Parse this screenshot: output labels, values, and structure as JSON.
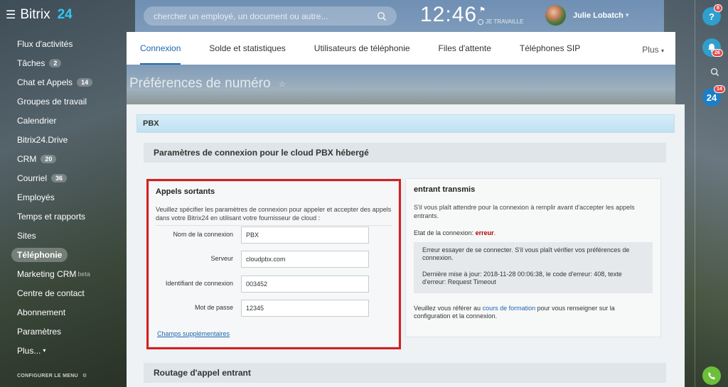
{
  "topbar": {
    "logo_text": "Bitrix",
    "logo_num": "24",
    "search_placeholder": "chercher un employé, un document ou autre...",
    "clock": "12:46",
    "work_status": "JE TRAVAILLE",
    "user_name": "Julie Lobatch"
  },
  "leftmenu": {
    "items": [
      {
        "label": "Flux d'activités"
      },
      {
        "label": "Tâches",
        "badge": "2"
      },
      {
        "label": "Chat et Appels",
        "badge": "14"
      },
      {
        "label": "Groupes de travail"
      },
      {
        "label": "Calendrier"
      },
      {
        "label": "Bitrix24.Drive"
      },
      {
        "label": "CRM",
        "badge": "20"
      },
      {
        "label": "Courriel",
        "badge": "36"
      },
      {
        "label": "Employés"
      },
      {
        "label": "Temps et rapports"
      },
      {
        "label": "Sites"
      },
      {
        "label": "Téléphonie"
      },
      {
        "label": "Marketing CRM",
        "beta": "beta"
      },
      {
        "label": "Centre de contact"
      },
      {
        "label": "Abonnement"
      },
      {
        "label": "Paramètres"
      },
      {
        "label": "Plus..."
      }
    ],
    "configure": "CONFIGURER LE MENU"
  },
  "rail": {
    "bell_badge": "26",
    "b24_label": "24",
    "b24_badge": "14",
    "help_label": "?",
    "help_badge": "8"
  },
  "tabs": {
    "items": [
      "Connexion",
      "Solde et statistiques",
      "Utilisateurs de téléphonie",
      "Files d'attente",
      "Téléphones SIP"
    ],
    "more": "Plus"
  },
  "page_title": "Préférences de numéro",
  "main": {
    "pbx_label": "PBX",
    "section1": "Paramètres de connexion pour le cloud PBX hébergé",
    "section2": "Routage d'appel entrant",
    "outgoing": {
      "title": "Appels sortants",
      "description": "Veuillez spécifier les paramètres de connexion pour appeler et accepter des appels dans votre Bitrix24 en utilisant votre fournisseur de cloud :",
      "fields": [
        {
          "label": "Nom de la connexion",
          "value": "PBX"
        },
        {
          "label": "Serveur",
          "value": "cloudpbx.com"
        },
        {
          "label": "Identifiant de connexion",
          "value": "003452"
        },
        {
          "label": "Mot de passe",
          "value": "12345"
        }
      ],
      "extra_link": "Champs supplémentaires"
    },
    "incoming": {
      "title": "entrant transmis",
      "description": "S'il vous plaît attendre pour la connexion à remplir avant d'accepter les appels entrants.",
      "status_label": "Etat de la connexion:",
      "status_value": "erreur",
      "error_msg": "Erreur essayer de se connecter. S'il vous plaît vérifier vos préférences de connexion.",
      "last_update": "Dernière mise à jour: 2018-11-28 00:06:38, le code d'erreur: 408, texte d'erreur: Request Timeout",
      "help_prefix": "Veuillez vous référer au",
      "help_link": "cours de formation",
      "help_suffix": "pour vous renseigner sur la configuration et la connexion."
    }
  },
  "colors": {
    "accent": "#2067b0",
    "highlight_border": "#d61f1f",
    "error": "#b40000"
  }
}
